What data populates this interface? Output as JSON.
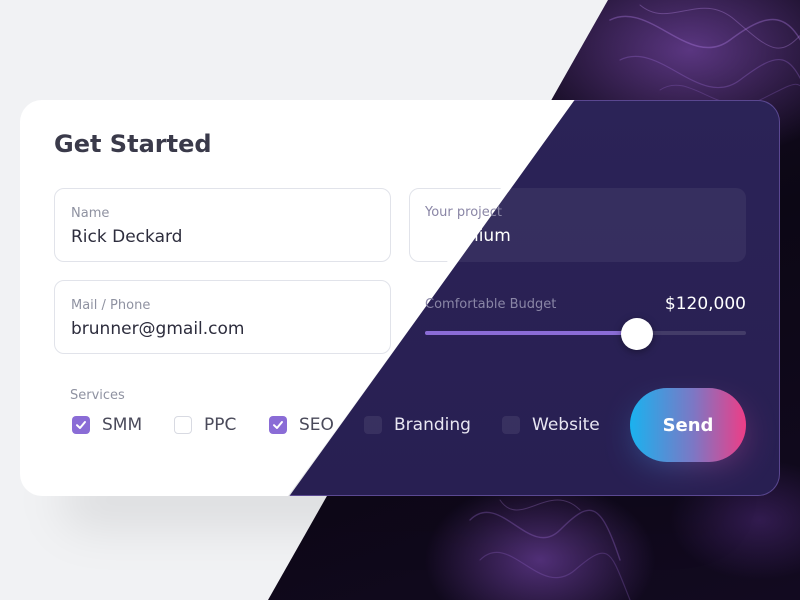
{
  "form": {
    "title": "Get Started",
    "name": {
      "label": "Name",
      "value": "Rick Deckard"
    },
    "project": {
      "label": "Your project",
      "value": "roobinium"
    },
    "contact": {
      "label": "Mail / Phone",
      "value": "brunner@gmail.com"
    },
    "budget": {
      "label": "Comfortable Budget",
      "value": "$120,000",
      "fraction": 0.66
    },
    "services": {
      "label": "Services",
      "items": [
        {
          "label": "SMM",
          "checked": true
        },
        {
          "label": "PPC",
          "checked": false
        },
        {
          "label": "SEO",
          "checked": true
        },
        {
          "label": "Branding",
          "checked": false
        },
        {
          "label": "Website",
          "checked": false
        }
      ]
    },
    "send_label": "Send"
  },
  "colors": {
    "accent": "#8a6cd6",
    "dark_panel": "#2b2357",
    "send_gradient_start": "#1ab2ef",
    "send_gradient_end": "#ee3d86"
  },
  "icons": {
    "checkbox_checked": "check-icon"
  }
}
